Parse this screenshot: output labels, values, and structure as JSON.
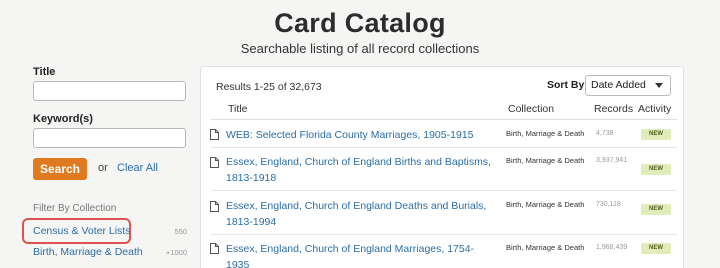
{
  "header": {
    "title": "Card Catalog",
    "subtitle": "Searchable listing of all record collections"
  },
  "sidebar": {
    "title_label": "Title",
    "title_value": "",
    "keyword_label": "Keyword(s)",
    "keyword_value": "",
    "search_button": "Search",
    "or_text": "or",
    "clear_all": "Clear All",
    "filter_heading": "Filter By Collection",
    "filters": [
      {
        "label": "Census & Voter Lists",
        "count": "550",
        "highlighted": true
      },
      {
        "label": "Birth, Marriage & Death",
        "count": "+1000",
        "highlighted": false
      }
    ]
  },
  "results": {
    "count_text": "Results 1-25 of 32,673",
    "sort_label": "Sort By",
    "sort_value": "Date Added",
    "columns": [
      "Title",
      "Collection",
      "Records",
      "Activity"
    ],
    "rows": [
      {
        "title": "WEB: Selected Florida County Marriages, 1905-1915",
        "collection": "Birth, Marriage & Death",
        "records": "4,738",
        "activity": "NEW"
      },
      {
        "title": "Essex, England, Church of England Births and Baptisms, 1813-1918",
        "collection": "Birth, Marriage & Death",
        "records": "3,937,941",
        "activity": "NEW"
      },
      {
        "title": "Essex, England, Church of England Deaths and Burials, 1813-1994",
        "collection": "Birth, Marriage & Death",
        "records": "730,118",
        "activity": "NEW"
      },
      {
        "title": "Essex, England, Church of England Marriages, 1754-1935",
        "collection": "Birth, Marriage & Death",
        "records": "1,968,439",
        "activity": "NEW"
      }
    ]
  },
  "icons": {
    "row_icon": "document-icon",
    "sort_caret": "caret-down-icon"
  },
  "colors": {
    "accent": "#e07a1f",
    "link": "#2a6ea8",
    "highlight": "#e0534d",
    "badge_bg": "#e2ecb9"
  }
}
